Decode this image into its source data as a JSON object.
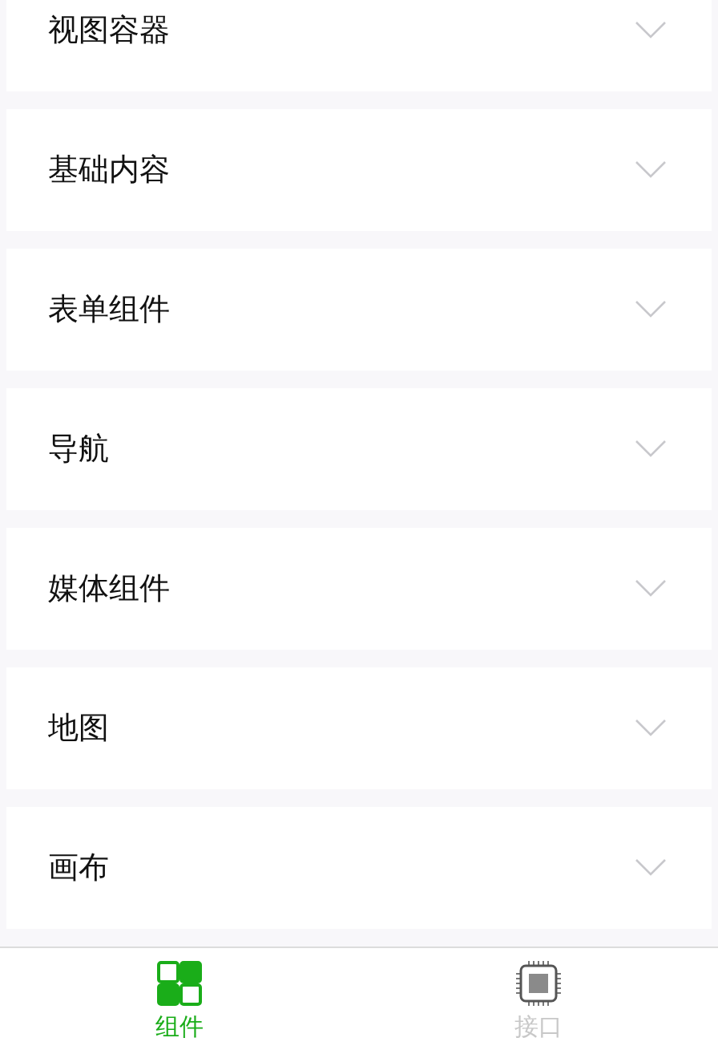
{
  "sections": [
    {
      "title": "视图容器",
      "expanded": false
    },
    {
      "title": "基础内容",
      "expanded": false
    },
    {
      "title": "表单组件",
      "expanded": false
    },
    {
      "title": "导航",
      "expanded": false
    },
    {
      "title": "媒体组件",
      "expanded": false
    },
    {
      "title": "地图",
      "expanded": false
    },
    {
      "title": "画布",
      "expanded": false
    }
  ],
  "tab_bar": [
    {
      "label": "组件",
      "kind": "grid",
      "selected": true
    },
    {
      "label": "接口",
      "kind": "chip",
      "selected": false
    }
  ]
}
